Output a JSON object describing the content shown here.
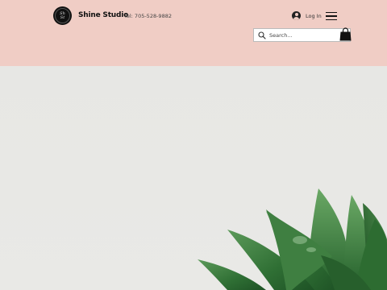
{
  "header": {
    "brand_name": "Shine Studio",
    "phone": "Tel: 705-528-9882",
    "login_label": "Log In",
    "logo_text": "Shine Studio",
    "background": "#f0cdc5"
  },
  "search": {
    "placeholder": "Search..."
  },
  "icons": {
    "search": "search-icon",
    "account": "account-icon",
    "menu": "hamburger-menu-icon",
    "cart": "shopping-bag-icon"
  },
  "hero": {
    "image": "succulent plant photo",
    "background": "#e8e8e5"
  }
}
